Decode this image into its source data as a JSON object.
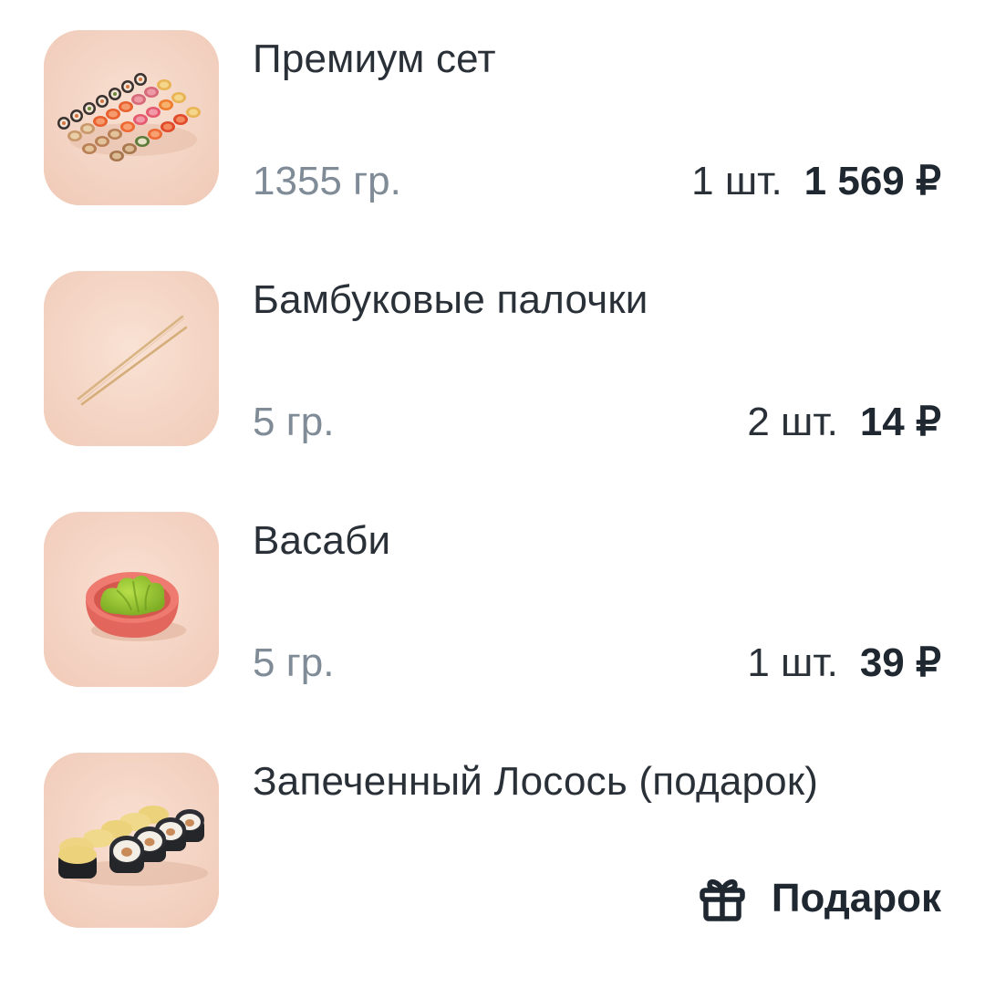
{
  "items": [
    {
      "image_icon": "sushi-set-icon",
      "name": "Премиум сет",
      "weight": "1355 гр.",
      "quantity": "1 шт.",
      "price": "1 569 ₽"
    },
    {
      "image_icon": "chopsticks-icon",
      "name": "Бамбуковые палочки",
      "weight": "5 гр.",
      "quantity": "2 шт.",
      "price": "14 ₽"
    },
    {
      "image_icon": "wasabi-icon",
      "name": "Васаби",
      "weight": "5 гр.",
      "quantity": "1 шт.",
      "price": "39 ₽"
    },
    {
      "image_icon": "salmon-rolls-icon",
      "name": "Запеченный Лосось (подарок)",
      "gift_icon": "gift-icon",
      "gift_label": "Подарок"
    }
  ],
  "colors": {
    "text_primary": "#1f2730",
    "text_secondary": "#7f8b96",
    "thumb_background": "#f5d6c6"
  }
}
